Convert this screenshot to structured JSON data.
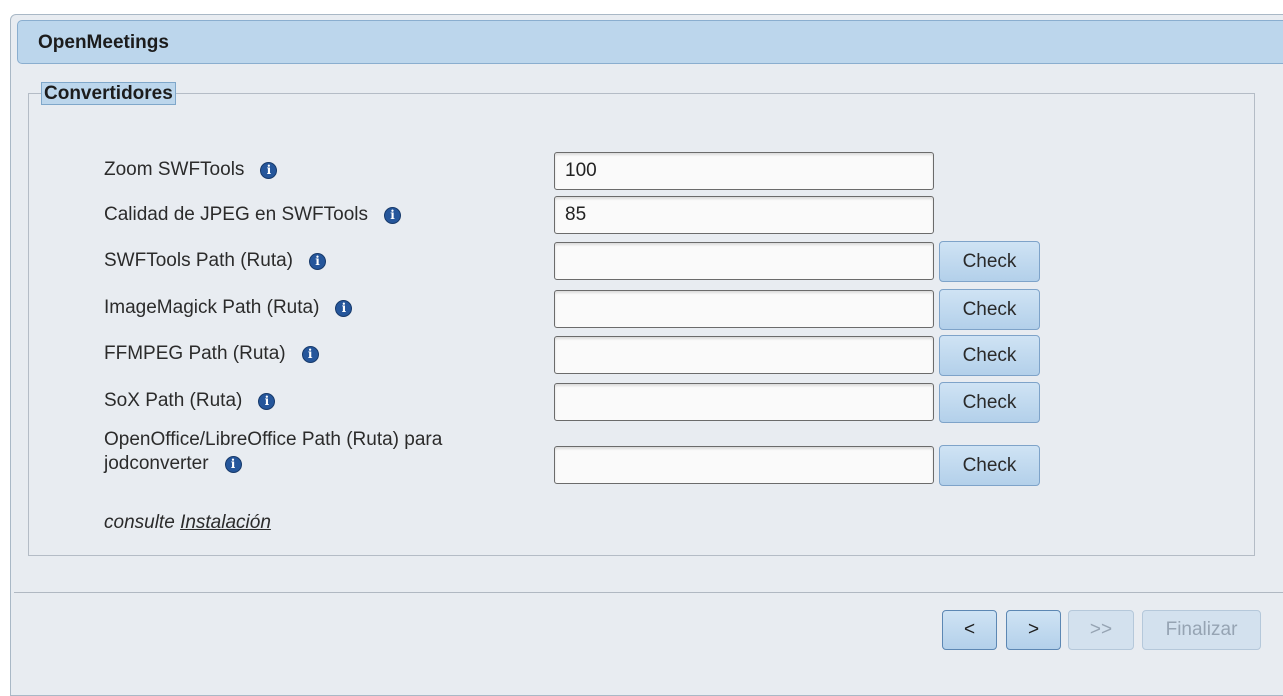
{
  "window": {
    "title": "OpenMeetings"
  },
  "section": {
    "legend": "Convertidores"
  },
  "fields": [
    {
      "label": "Zoom SWFTools",
      "value": "100",
      "has_check": false
    },
    {
      "label": "Calidad de JPEG en SWFTools",
      "value": "85",
      "has_check": false
    },
    {
      "label": "SWFTools Path (Ruta)",
      "value": "",
      "has_check": true
    },
    {
      "label": "ImageMagick Path (Ruta)",
      "value": "",
      "has_check": true
    },
    {
      "label": "FFMPEG Path (Ruta)",
      "value": "",
      "has_check": true
    },
    {
      "label": "SoX Path (Ruta)",
      "value": "",
      "has_check": true
    },
    {
      "label_line1": "OpenOffice/LibreOffice Path (Ruta) para",
      "label_line2": "jodconverter",
      "value": "",
      "has_check": true
    }
  ],
  "check_label": "Check",
  "info_glyph": "i",
  "note": {
    "prefix": "consulte",
    "link": "Instalación"
  },
  "footer": {
    "prev_label": "<",
    "next_label": ">",
    "last_label": ">>",
    "finish_label": "Finalizar"
  }
}
